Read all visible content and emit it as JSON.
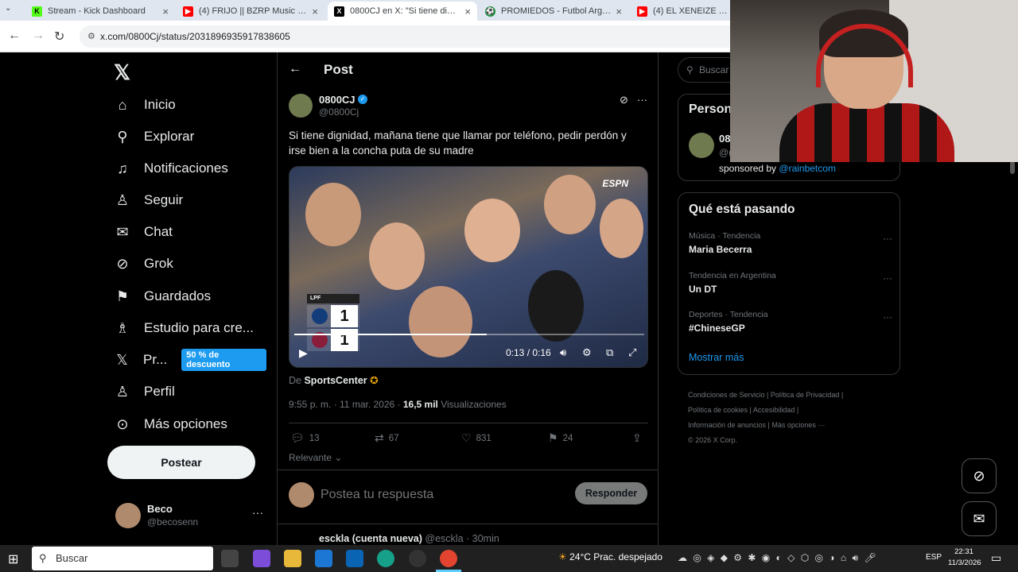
{
  "browser": {
    "tabs": [
      {
        "title": "Stream - Kick Dashboard",
        "active": false,
        "icon": "kick-icon",
        "color": "#53fc18"
      },
      {
        "title": "(4) FRIJO || BZRP Music Sessions",
        "active": false,
        "icon": "youtube-icon",
        "color": "#ff0000"
      },
      {
        "title": "0800CJ en X: \"Si tiene dignidad",
        "active": true,
        "icon": "x-icon",
        "color": "#000000"
      },
      {
        "title": "PROMIEDOS - Futbol Argentino",
        "active": false,
        "icon": "promiedos-icon",
        "color": "#1e8f3e"
      },
      {
        "title": "(4) EL XENEIZE Y EL CICL",
        "active": false,
        "icon": "youtube-icon",
        "color": "#ff0000"
      }
    ],
    "url": "x.com/0800Cj/status/2031896935917838605"
  },
  "nav": {
    "items": [
      {
        "label": "Inicio",
        "icon": "home-icon",
        "glyph": "⌂"
      },
      {
        "label": "Explorar",
        "icon": "search-icon",
        "glyph": "⚲"
      },
      {
        "label": "Notificaciones",
        "icon": "bell-icon",
        "glyph": "🔔︎"
      },
      {
        "label": "Seguir",
        "icon": "follow-icon",
        "glyph": "👤︎"
      },
      {
        "label": "Chat",
        "icon": "mail-icon",
        "glyph": "✉"
      },
      {
        "label": "Grok",
        "icon": "grok-icon",
        "glyph": "⊘"
      },
      {
        "label": "Guardados",
        "icon": "bookmark-icon",
        "glyph": "🔖︎"
      },
      {
        "label": "Estudio para cre...",
        "icon": "studio-icon",
        "glyph": "♙"
      },
      {
        "label": "Pr...",
        "icon": "x-premium-icon",
        "glyph": "𝕏"
      },
      {
        "label": "Perfil",
        "icon": "profile-icon",
        "glyph": "👤︎"
      },
      {
        "label": "Más opciones",
        "icon": "more-circle-icon",
        "glyph": "⊙"
      }
    ],
    "premium_badge": "50 % de descuento",
    "post_button": "Postear",
    "user": {
      "name": "Beco",
      "handle": "@becosenn"
    }
  },
  "post": {
    "header": "Post",
    "author_name": "0800CJ",
    "author_handle": "@0800Cj",
    "text": "Si tiene dignidad, mañana tiene que llamar por teléfono, pedir perdón y irse bien a la concha puta de su madre",
    "video": {
      "broadcaster": "ESPN",
      "score_header": "LPF",
      "home_score": "1",
      "away_score": "1",
      "time": "0:13 / 0:16",
      "progress": 0.55
    },
    "source_prefix": "De",
    "source_name": "SportsCenter",
    "timestamp": "9:55 p. m. · 11 mar. 2026 · ",
    "views_count": "16,5 mil",
    "views_label": " Visualizaciones",
    "stats": {
      "replies": "13",
      "reposts": "67",
      "likes": "831",
      "bookmarks": "24"
    },
    "sort_label": "Relevante",
    "reply_placeholder": "Postea tu respuesta",
    "reply_button": "Responder",
    "next_reply_name": "esckla (cuenta nueva)",
    "next_reply_meta": " @esckla · 30min"
  },
  "sidebar": {
    "search_placeholder": "Buscar",
    "people_title": "Person",
    "people_name": "08",
    "people_handle": "@(",
    "sponsored_prefix": "sponsored by ",
    "sponsored_handle": "@rainbetcom",
    "trends_title": "Qué está pasando",
    "trends": [
      {
        "context": "Música · Tendencia",
        "name": "Maria Becerra"
      },
      {
        "context": "Tendencia en Argentina",
        "name": "Un DT"
      },
      {
        "context": "Deportes · Tendencia",
        "name": "#ChineseGP"
      }
    ],
    "show_more": "Mostrar más",
    "footer_lines": [
      "Condiciones de Servicio  |  Política de Privacidad  |",
      "Política de cookies  |  Accesibilidad  |",
      "Información de anuncios  |  Más opciones ···",
      "© 2026 X Corp."
    ]
  },
  "taskbar": {
    "search": "Buscar",
    "weather": "24°C  Prac. despejado",
    "lang": "ESP",
    "time": "22:31",
    "date": "11/3/2026"
  },
  "colors": {
    "accent": "#1d9bf0",
    "background": "#000000",
    "muted": "#71767b"
  }
}
